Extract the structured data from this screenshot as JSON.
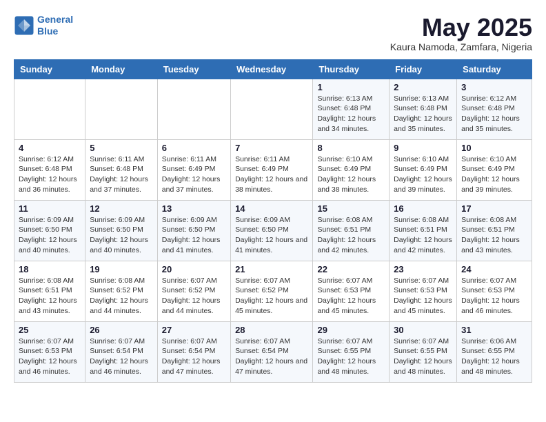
{
  "logo": {
    "line1": "General",
    "line2": "Blue"
  },
  "title": "May 2025",
  "location": "Kaura Namoda, Zamfara, Nigeria",
  "weekdays": [
    "Sunday",
    "Monday",
    "Tuesday",
    "Wednesday",
    "Thursday",
    "Friday",
    "Saturday"
  ],
  "weeks": [
    [
      {
        "day": "",
        "sunrise": "",
        "sunset": "",
        "daylight": ""
      },
      {
        "day": "",
        "sunrise": "",
        "sunset": "",
        "daylight": ""
      },
      {
        "day": "",
        "sunrise": "",
        "sunset": "",
        "daylight": ""
      },
      {
        "day": "",
        "sunrise": "",
        "sunset": "",
        "daylight": ""
      },
      {
        "day": "1",
        "sunrise": "Sunrise: 6:13 AM",
        "sunset": "Sunset: 6:48 PM",
        "daylight": "Daylight: 12 hours and 34 minutes."
      },
      {
        "day": "2",
        "sunrise": "Sunrise: 6:13 AM",
        "sunset": "Sunset: 6:48 PM",
        "daylight": "Daylight: 12 hours and 35 minutes."
      },
      {
        "day": "3",
        "sunrise": "Sunrise: 6:12 AM",
        "sunset": "Sunset: 6:48 PM",
        "daylight": "Daylight: 12 hours and 35 minutes."
      }
    ],
    [
      {
        "day": "4",
        "sunrise": "Sunrise: 6:12 AM",
        "sunset": "Sunset: 6:48 PM",
        "daylight": "Daylight: 12 hours and 36 minutes."
      },
      {
        "day": "5",
        "sunrise": "Sunrise: 6:11 AM",
        "sunset": "Sunset: 6:48 PM",
        "daylight": "Daylight: 12 hours and 37 minutes."
      },
      {
        "day": "6",
        "sunrise": "Sunrise: 6:11 AM",
        "sunset": "Sunset: 6:49 PM",
        "daylight": "Daylight: 12 hours and 37 minutes."
      },
      {
        "day": "7",
        "sunrise": "Sunrise: 6:11 AM",
        "sunset": "Sunset: 6:49 PM",
        "daylight": "Daylight: 12 hours and 38 minutes."
      },
      {
        "day": "8",
        "sunrise": "Sunrise: 6:10 AM",
        "sunset": "Sunset: 6:49 PM",
        "daylight": "Daylight: 12 hours and 38 minutes."
      },
      {
        "day": "9",
        "sunrise": "Sunrise: 6:10 AM",
        "sunset": "Sunset: 6:49 PM",
        "daylight": "Daylight: 12 hours and 39 minutes."
      },
      {
        "day": "10",
        "sunrise": "Sunrise: 6:10 AM",
        "sunset": "Sunset: 6:49 PM",
        "daylight": "Daylight: 12 hours and 39 minutes."
      }
    ],
    [
      {
        "day": "11",
        "sunrise": "Sunrise: 6:09 AM",
        "sunset": "Sunset: 6:50 PM",
        "daylight": "Daylight: 12 hours and 40 minutes."
      },
      {
        "day": "12",
        "sunrise": "Sunrise: 6:09 AM",
        "sunset": "Sunset: 6:50 PM",
        "daylight": "Daylight: 12 hours and 40 minutes."
      },
      {
        "day": "13",
        "sunrise": "Sunrise: 6:09 AM",
        "sunset": "Sunset: 6:50 PM",
        "daylight": "Daylight: 12 hours and 41 minutes."
      },
      {
        "day": "14",
        "sunrise": "Sunrise: 6:09 AM",
        "sunset": "Sunset: 6:50 PM",
        "daylight": "Daylight: 12 hours and 41 minutes."
      },
      {
        "day": "15",
        "sunrise": "Sunrise: 6:08 AM",
        "sunset": "Sunset: 6:51 PM",
        "daylight": "Daylight: 12 hours and 42 minutes."
      },
      {
        "day": "16",
        "sunrise": "Sunrise: 6:08 AM",
        "sunset": "Sunset: 6:51 PM",
        "daylight": "Daylight: 12 hours and 42 minutes."
      },
      {
        "day": "17",
        "sunrise": "Sunrise: 6:08 AM",
        "sunset": "Sunset: 6:51 PM",
        "daylight": "Daylight: 12 hours and 43 minutes."
      }
    ],
    [
      {
        "day": "18",
        "sunrise": "Sunrise: 6:08 AM",
        "sunset": "Sunset: 6:51 PM",
        "daylight": "Daylight: 12 hours and 43 minutes."
      },
      {
        "day": "19",
        "sunrise": "Sunrise: 6:08 AM",
        "sunset": "Sunset: 6:52 PM",
        "daylight": "Daylight: 12 hours and 44 minutes."
      },
      {
        "day": "20",
        "sunrise": "Sunrise: 6:07 AM",
        "sunset": "Sunset: 6:52 PM",
        "daylight": "Daylight: 12 hours and 44 minutes."
      },
      {
        "day": "21",
        "sunrise": "Sunrise: 6:07 AM",
        "sunset": "Sunset: 6:52 PM",
        "daylight": "Daylight: 12 hours and 45 minutes."
      },
      {
        "day": "22",
        "sunrise": "Sunrise: 6:07 AM",
        "sunset": "Sunset: 6:53 PM",
        "daylight": "Daylight: 12 hours and 45 minutes."
      },
      {
        "day": "23",
        "sunrise": "Sunrise: 6:07 AM",
        "sunset": "Sunset: 6:53 PM",
        "daylight": "Daylight: 12 hours and 45 minutes."
      },
      {
        "day": "24",
        "sunrise": "Sunrise: 6:07 AM",
        "sunset": "Sunset: 6:53 PM",
        "daylight": "Daylight: 12 hours and 46 minutes."
      }
    ],
    [
      {
        "day": "25",
        "sunrise": "Sunrise: 6:07 AM",
        "sunset": "Sunset: 6:53 PM",
        "daylight": "Daylight: 12 hours and 46 minutes."
      },
      {
        "day": "26",
        "sunrise": "Sunrise: 6:07 AM",
        "sunset": "Sunset: 6:54 PM",
        "daylight": "Daylight: 12 hours and 46 minutes."
      },
      {
        "day": "27",
        "sunrise": "Sunrise: 6:07 AM",
        "sunset": "Sunset: 6:54 PM",
        "daylight": "Daylight: 12 hours and 47 minutes."
      },
      {
        "day": "28",
        "sunrise": "Sunrise: 6:07 AM",
        "sunset": "Sunset: 6:54 PM",
        "daylight": "Daylight: 12 hours and 47 minutes."
      },
      {
        "day": "29",
        "sunrise": "Sunrise: 6:07 AM",
        "sunset": "Sunset: 6:55 PM",
        "daylight": "Daylight: 12 hours and 48 minutes."
      },
      {
        "day": "30",
        "sunrise": "Sunrise: 6:07 AM",
        "sunset": "Sunset: 6:55 PM",
        "daylight": "Daylight: 12 hours and 48 minutes."
      },
      {
        "day": "31",
        "sunrise": "Sunrise: 6:06 AM",
        "sunset": "Sunset: 6:55 PM",
        "daylight": "Daylight: 12 hours and 48 minutes."
      }
    ]
  ]
}
